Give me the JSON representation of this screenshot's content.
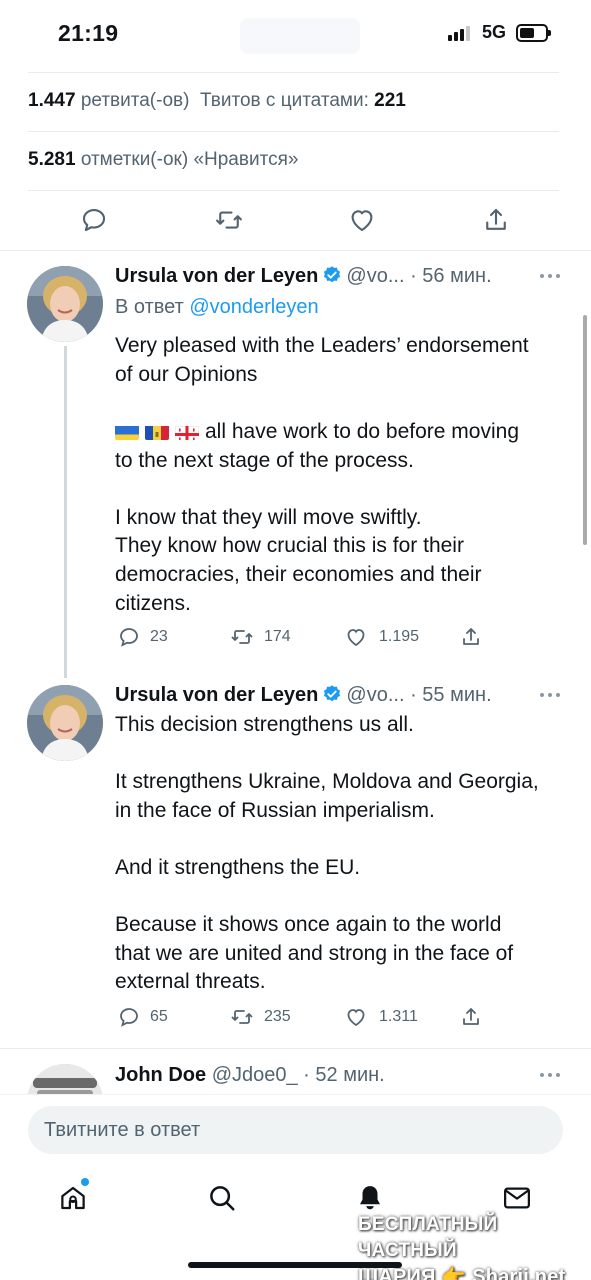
{
  "status_bar": {
    "time": "21:19",
    "network": "5G"
  },
  "stats": {
    "retweets_count": "1.447",
    "retweets_label": "ретвита(-ов)",
    "quotes_label": "Твитов с цитатами:",
    "quotes_count": "221",
    "likes_count": "5.281",
    "likes_label": "отметки(-ок) «Нравится»"
  },
  "main_actions": [
    "reply-icon",
    "retweet-icon",
    "like-icon",
    "share-icon"
  ],
  "tweets": [
    {
      "name": "Ursula von der Leyen",
      "handle": "@vo...",
      "time": "· 56 мин.",
      "reply_prefix": "В ответ",
      "reply_to": "@vonderleyen",
      "text_1": "Very pleased with the Leaders’ endorsement\nof our Opinions",
      "flags": [
        "Ukraine",
        "Moldova",
        "Georgia"
      ],
      "text_2": "all have work to do before moving\nto the next stage of the process.\n\nI know that they will move swiftly.\nThey know how crucial this is for their\ndemocracies, their economies and their\ncitizens.",
      "replies": "23",
      "retweets": "174",
      "likes": "1.195"
    },
    {
      "name": "Ursula von der Leyen",
      "handle": "@vo...",
      "time": "· 55 мин.",
      "text": "This decision strengthens us all.\n\nIt strengthens Ukraine, Moldova and Georgia,\nin the face of Russian imperialism.\n\nAnd it strengthens the EU.\n\nBecause it shows once again to the world\nthat we are united and strong in the face of\nexternal threats.",
      "replies": "65",
      "retweets": "235",
      "likes": "1.311"
    },
    {
      "name": "John Doe",
      "handle": "@Jdoe0_",
      "time": "· 52 мин."
    }
  ],
  "composer": {
    "placeholder": "Твитните в ответ"
  },
  "tab_bar": [
    "home-icon",
    "search-icon",
    "notifications-icon",
    "messages-icon"
  ],
  "watermark": {
    "line1": "БЕСПЛАТНЫЙ ЧАСТНЫЙ",
    "line2": "ШАРИЯ 👉 Sharij.net"
  },
  "colors": {
    "accent": "#1d9bf0",
    "text": "#0f1419",
    "secondary": "#536471"
  }
}
